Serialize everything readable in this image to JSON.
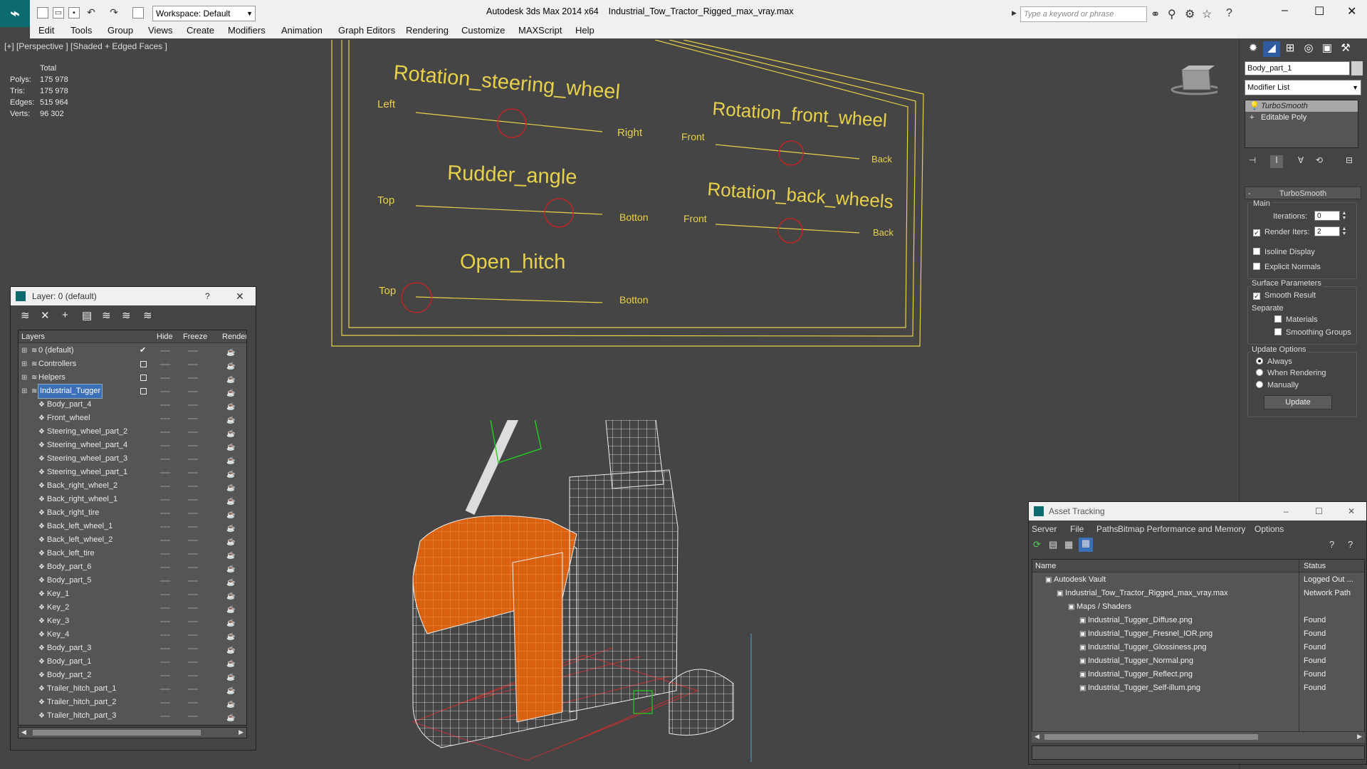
{
  "app": {
    "title": "Autodesk 3ds Max  2014 x64",
    "file": "Industrial_Tow_Tractor_Rigged_max_vray.max",
    "workspace": "Workspace: Default",
    "search_placeholder": "Type a keyword or phrase"
  },
  "menu": [
    "Edit",
    "Tools",
    "Group",
    "Views",
    "Create",
    "Modifiers",
    "Animation",
    "Graph Editors",
    "Rendering",
    "Customize",
    "MAXScript",
    "Help"
  ],
  "viewport": {
    "label": "[+] [Perspective ] [Shaded + Edged Faces ]",
    "stats": {
      "total_label": "Total",
      "rows": [
        {
          "label": "Polys:",
          "value": "175 978"
        },
        {
          "label": "Tris:",
          "value": "175 978"
        },
        {
          "label": "Edges:",
          "value": "515 964"
        },
        {
          "label": "Verts:",
          "value": "96 302"
        }
      ]
    },
    "rig": {
      "steering": {
        "title": "Rotation_steering_wheel",
        "left": "Left",
        "right": "Right"
      },
      "front_wheel": {
        "title": "Rotation_front_wheel",
        "left": "Front",
        "right": "Back"
      },
      "rudder": {
        "title": "Rudder_angle",
        "left": "Top",
        "right": "Botton"
      },
      "back_wheels": {
        "title": "Rotation_back_wheels",
        "left": "Front",
        "right": "Back"
      },
      "hitch": {
        "title": "Open_hitch",
        "left": "Top",
        "right": "Botton"
      }
    }
  },
  "command_panel": {
    "object_name": "Body_part_1",
    "modifier_list": "Modifier List",
    "stack": [
      "TurboSmooth",
      "Editable Poly"
    ],
    "rollout_title": "TurboSmooth",
    "main_group": "Main",
    "iterations_label": "Iterations:",
    "iterations_value": "0",
    "render_iters_label": "Render Iters:",
    "render_iters_value": "2",
    "isoline": "Isoline Display",
    "explicit": "Explicit Normals",
    "surface_group": "Surface Parameters",
    "smooth_result": "Smooth Result",
    "separate": "Separate",
    "materials": "Materials",
    "smoothing_groups": "Smoothing Groups",
    "update_group": "Update Options",
    "always": "Always",
    "when_rendering": "When Rendering",
    "manually": "Manually",
    "update_button": "Update"
  },
  "layer_window": {
    "title": "Layer: 0 (default)",
    "help": "?",
    "columns": {
      "layers": "Layers",
      "hide": "Hide",
      "freeze": "Freeze",
      "render": "Render"
    },
    "rows": [
      {
        "name": "0 (default)",
        "indent": 1,
        "type": "layer",
        "check": true
      },
      {
        "name": "Controllers",
        "indent": 1,
        "type": "layer",
        "box": true
      },
      {
        "name": "Helpers",
        "indent": 1,
        "type": "layer",
        "box": true
      },
      {
        "name": "Industrial_Tugger",
        "indent": 1,
        "type": "layer",
        "box": true,
        "selected": true
      },
      {
        "name": "Body_part_4",
        "indent": 2,
        "type": "obj"
      },
      {
        "name": "Front_wheel",
        "indent": 2,
        "type": "obj"
      },
      {
        "name": "Steering_wheel_part_2",
        "indent": 2,
        "type": "obj"
      },
      {
        "name": "Steering_wheel_part_4",
        "indent": 2,
        "type": "obj"
      },
      {
        "name": "Steering_wheel_part_3",
        "indent": 2,
        "type": "obj"
      },
      {
        "name": "Steering_wheel_part_1",
        "indent": 2,
        "type": "obj"
      },
      {
        "name": "Back_right_wheel_2",
        "indent": 2,
        "type": "obj"
      },
      {
        "name": "Back_right_wheel_1",
        "indent": 2,
        "type": "obj"
      },
      {
        "name": "Back_right_tire",
        "indent": 2,
        "type": "obj"
      },
      {
        "name": "Back_left_wheel_1",
        "indent": 2,
        "type": "obj"
      },
      {
        "name": "Back_left_wheel_2",
        "indent": 2,
        "type": "obj"
      },
      {
        "name": "Back_left_tire",
        "indent": 2,
        "type": "obj"
      },
      {
        "name": "Body_part_6",
        "indent": 2,
        "type": "obj"
      },
      {
        "name": "Body_part_5",
        "indent": 2,
        "type": "obj"
      },
      {
        "name": "Key_1",
        "indent": 2,
        "type": "obj"
      },
      {
        "name": "Key_2",
        "indent": 2,
        "type": "obj"
      },
      {
        "name": "Key_3",
        "indent": 2,
        "type": "obj"
      },
      {
        "name": "Key_4",
        "indent": 2,
        "type": "obj"
      },
      {
        "name": "Body_part_3",
        "indent": 2,
        "type": "obj"
      },
      {
        "name": "Body_part_1",
        "indent": 2,
        "type": "obj"
      },
      {
        "name": "Body_part_2",
        "indent": 2,
        "type": "obj"
      },
      {
        "name": "Trailer_hitch_part_1",
        "indent": 2,
        "type": "obj"
      },
      {
        "name": "Trailer_hitch_part_2",
        "indent": 2,
        "type": "obj"
      },
      {
        "name": "Trailer_hitch_part_3",
        "indent": 2,
        "type": "obj"
      }
    ]
  },
  "asset_tracking": {
    "title": "Asset Tracking",
    "menu": [
      "Server",
      "File",
      "Paths",
      "Bitmap Performance and Memory",
      "Options"
    ],
    "columns": {
      "name": "Name",
      "status": "Status"
    },
    "rows": [
      {
        "name": "Autodesk Vault",
        "status": "Logged Out ...",
        "indent": 1
      },
      {
        "name": "Industrial_Tow_Tractor_Rigged_max_vray.max",
        "status": "Network Path",
        "indent": 2
      },
      {
        "name": "Maps / Shaders",
        "status": "",
        "indent": 3
      },
      {
        "name": "Industrial_Tugger_Diffuse.png",
        "status": "Found",
        "indent": 4
      },
      {
        "name": "Industrial_Tugger_Fresnel_IOR.png",
        "status": "Found",
        "indent": 4
      },
      {
        "name": "Industrial_Tugger_Glossiness.png",
        "status": "Found",
        "indent": 4
      },
      {
        "name": "Industrial_Tugger_Normal.png",
        "status": "Found",
        "indent": 4
      },
      {
        "name": "Industrial_Tugger_Reflect.png",
        "status": "Found",
        "indent": 4
      },
      {
        "name": "Industrial_Tugger_Self-illum.png",
        "status": "Found",
        "indent": 4
      }
    ]
  },
  "colors": {
    "rig_yellow": "#e8d14a",
    "handle_red": "#d02020",
    "body_orange": "#e06010",
    "accent_teal": "#0c6b71"
  }
}
